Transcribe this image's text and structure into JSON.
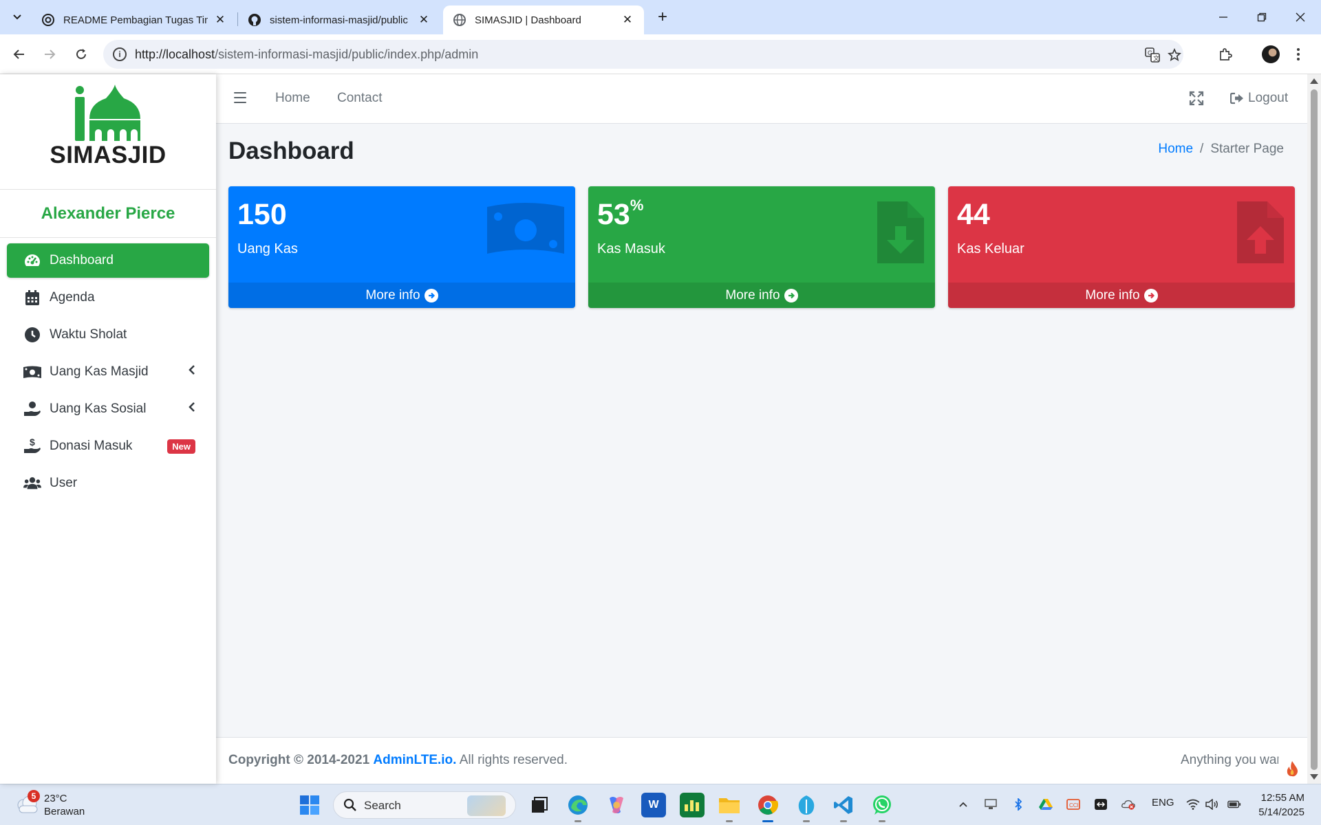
{
  "browser": {
    "tabs": [
      {
        "title": "README Pembagian Tugas Tim",
        "icon": "openai-icon"
      },
      {
        "title": "sistem-informasi-masjid/public",
        "icon": "github-icon"
      },
      {
        "title": "SIMASJID | Dashboard",
        "icon": "globe-icon",
        "active": true
      }
    ],
    "url_host": "http://localhost",
    "url_path": "/sistem-informasi-masjid/public/index.php/admin"
  },
  "sidebar": {
    "brand": "SIMASJID",
    "user": "Alexander Pierce",
    "items": [
      {
        "label": "Dashboard",
        "icon": "tachometer-icon",
        "active": true
      },
      {
        "label": "Agenda",
        "icon": "calendar-icon"
      },
      {
        "label": "Waktu Sholat",
        "icon": "clock-icon"
      },
      {
        "label": "Uang Kas Masjid",
        "icon": "money-bill-icon",
        "has_children": true
      },
      {
        "label": "Uang Kas Sosial",
        "icon": "hand-holding-icon",
        "has_children": true
      },
      {
        "label": "Donasi Masuk",
        "icon": "hand-holding-usd-icon",
        "badge": "New"
      },
      {
        "label": "User",
        "icon": "users-icon"
      }
    ]
  },
  "topnav": {
    "home": "Home",
    "contact": "Contact",
    "logout": "Logout"
  },
  "page": {
    "title": "Dashboard",
    "breadcrumb_home": "Home",
    "breadcrumb_current": "Starter Page"
  },
  "boxes": [
    {
      "value": "150",
      "suffix": "",
      "label": "Uang Kas",
      "more": "More info",
      "color": "#007bff",
      "icon": "money-bill-icon"
    },
    {
      "value": "53",
      "suffix": "%",
      "label": "Kas Masuk",
      "more": "More info",
      "color": "#28a745",
      "icon": "file-download-icon"
    },
    {
      "value": "44",
      "suffix": "",
      "label": "Kas Keluar",
      "more": "More info",
      "color": "#dc3545",
      "icon": "file-upload-icon"
    }
  ],
  "footer": {
    "copyright": "Copyright © 2014-2021",
    "brand_link": "AdminLTE.io.",
    "rights": "All rights reserved.",
    "right_text": "Anything you want"
  },
  "taskbar": {
    "weather_temp": "23°C",
    "weather_cond": "Berawan",
    "weather_badge": "5",
    "search": "Search",
    "lang": "ENG",
    "time": "12:55 AM",
    "date": "5/14/2025"
  }
}
